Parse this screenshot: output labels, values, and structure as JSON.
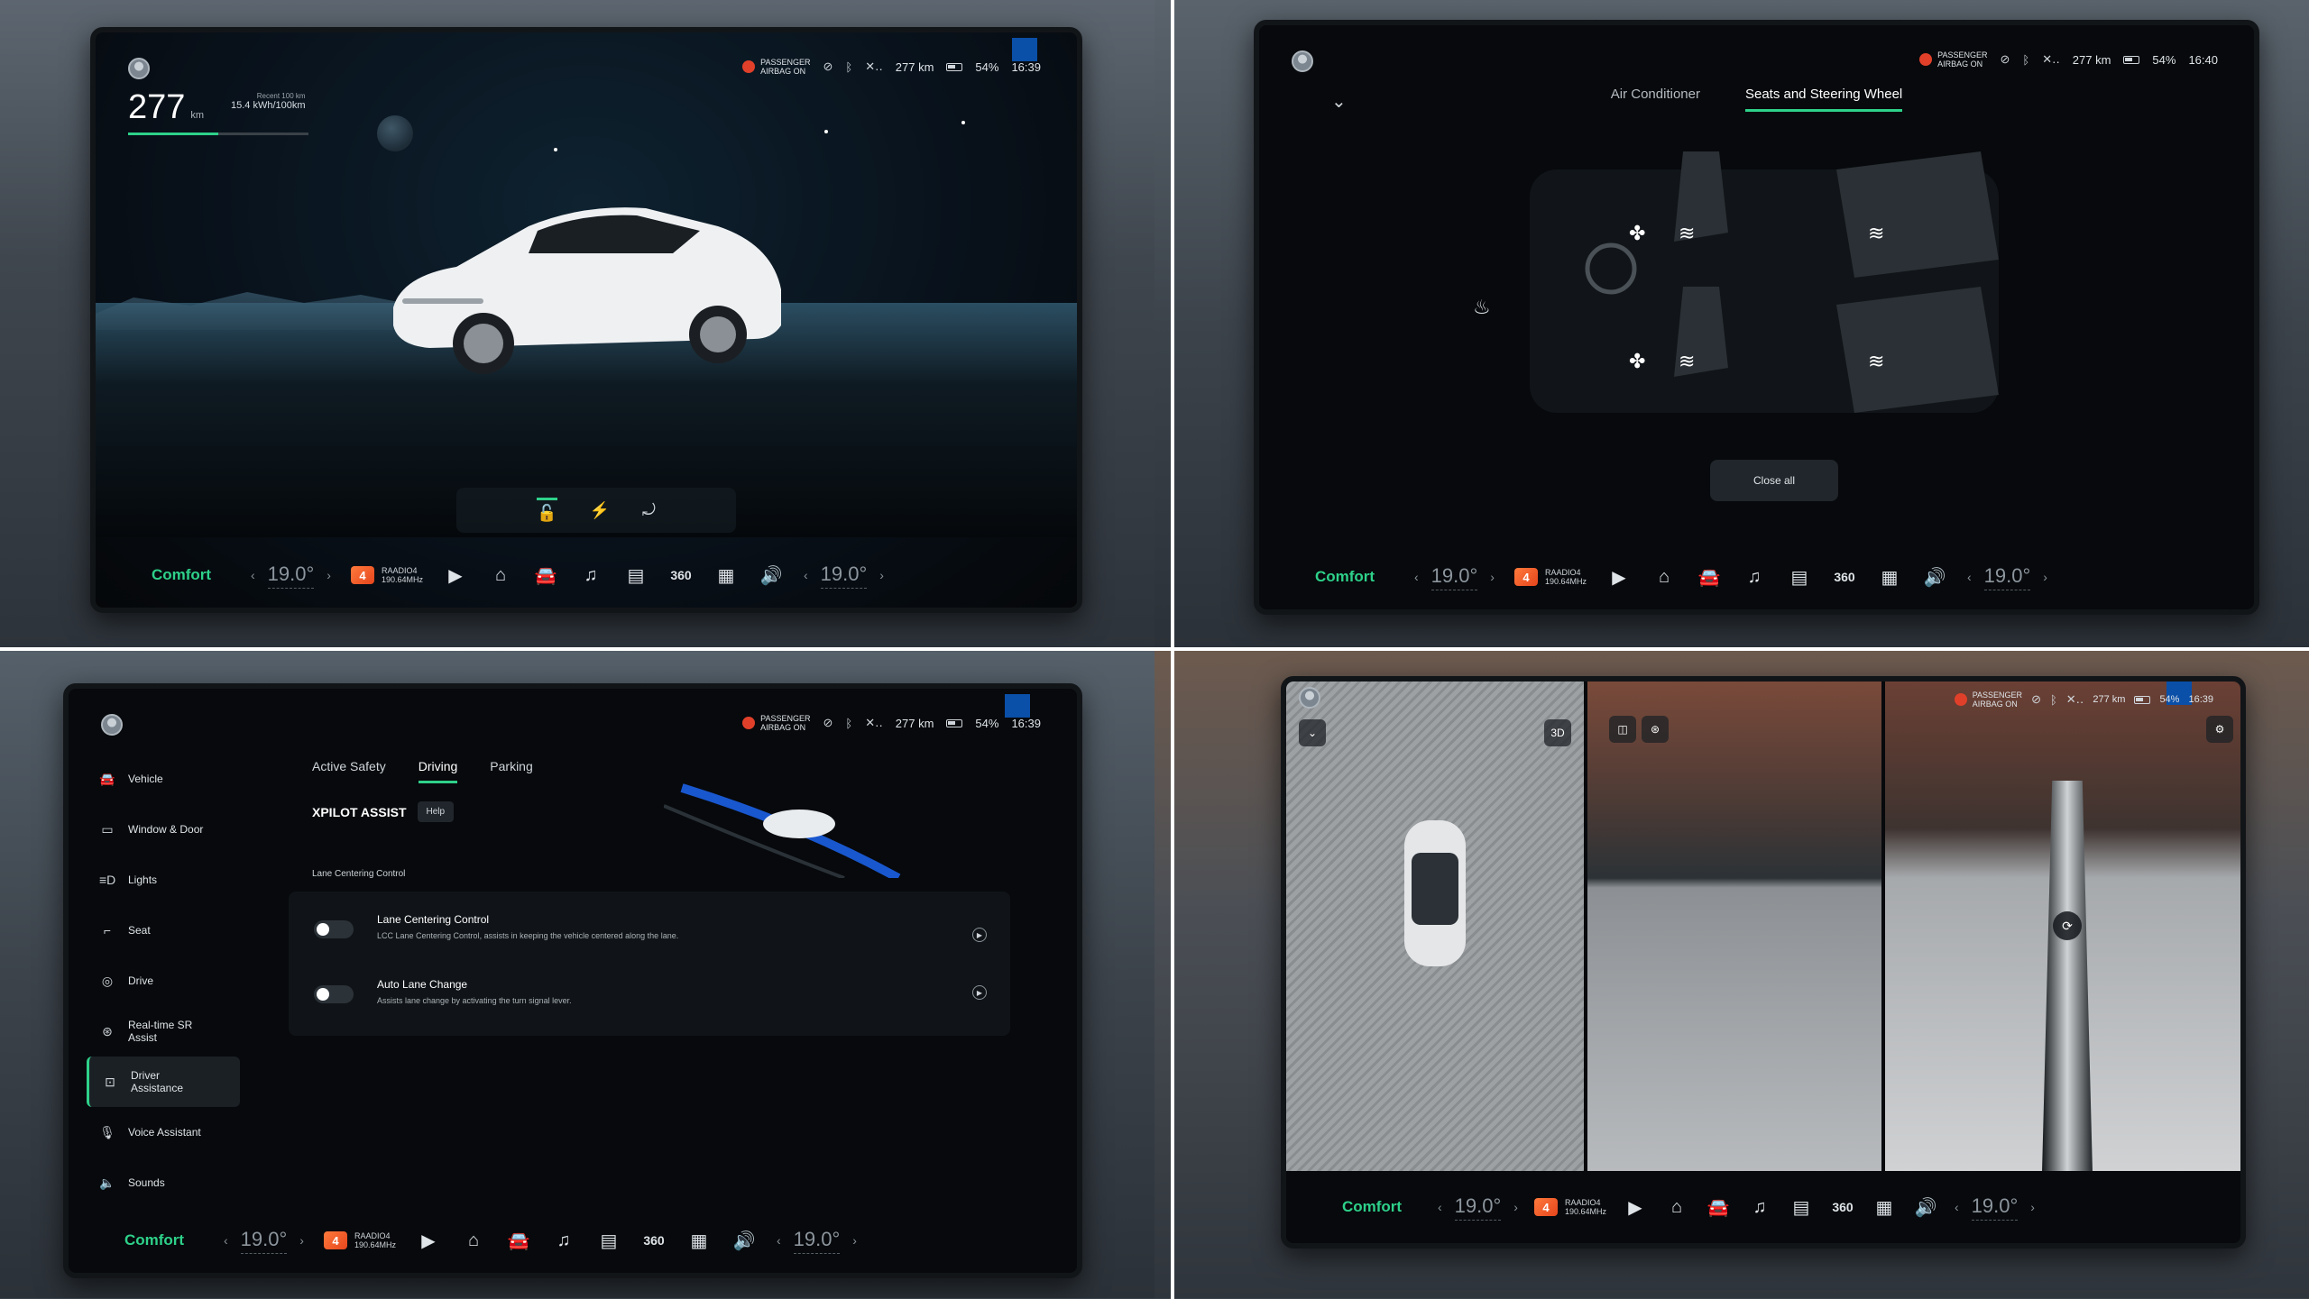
{
  "status": {
    "airbag": [
      "PASSENGER",
      "AIRBAG ON"
    ],
    "range": "277 km",
    "battery": "54%",
    "times": [
      "16:39",
      "16:40",
      "16:39",
      "16:39"
    ]
  },
  "dock": {
    "mode": "Comfort",
    "temp_left": "19.0°",
    "temp_right": "19.0°",
    "radio_badge": "4",
    "radio_name": "RAADIO4",
    "radio_freq": "190.64MHz",
    "icons": [
      "play-icon",
      "home-icon",
      "car-icon",
      "music-icon",
      "seat-icon",
      "360-icon",
      "apps-icon",
      "volume-icon"
    ],
    "label_360": "360"
  },
  "screen1": {
    "range_value": "277",
    "range_unit": "km",
    "range_fill": 0.5,
    "consumption_label": "Recent 100 km",
    "consumption_value": "15.4 kWh/100km",
    "controls": [
      "unlock-icon",
      "charge-icon",
      "tailgate-icon"
    ]
  },
  "screen2": {
    "tabs": [
      "Air Conditioner",
      "Seats and Steering Wheel"
    ],
    "active_tab": "Seats and Steering Wheel",
    "close_all": "Close all"
  },
  "screen3": {
    "sidebar": [
      {
        "label": "Vehicle",
        "icon": "car-icon"
      },
      {
        "label": "Window & Door",
        "icon": "window-icon"
      },
      {
        "label": "Lights",
        "icon": "lights-icon"
      },
      {
        "label": "Seat",
        "icon": "seat-icon"
      },
      {
        "label": "Drive",
        "icon": "steering-icon"
      },
      {
        "label": "Real-time SR Assist",
        "icon": "sr-icon"
      },
      {
        "label": "Driver Assistance",
        "icon": "assist-icon"
      },
      {
        "label": "Voice Assistant",
        "icon": "mic-icon"
      },
      {
        "label": "Sounds",
        "icon": "speaker-icon"
      }
    ],
    "active_item": "Driver Assistance",
    "tabs": [
      "Active Safety",
      "Driving",
      "Parking"
    ],
    "active_tab": "Driving",
    "section_title": "XPILOT ASSIST",
    "help": "Help",
    "section_label": "Lane Centering Control",
    "options": [
      {
        "title": "Lane Centering Control",
        "desc": "LCC Lane Centering Control, assists in keeping the vehicle centered along the lane.",
        "enabled": false
      },
      {
        "title": "Auto Lane Change",
        "desc": "Assists lane change by activating the turn signal lever.",
        "enabled": false
      }
    ]
  },
  "screen4": {
    "view_3d": "3D"
  },
  "colors": {
    "accent": "#2ed18a",
    "radio_badge": "#ff6a2c",
    "airbag": "#e0402a",
    "marker": "#0a4fa8"
  }
}
